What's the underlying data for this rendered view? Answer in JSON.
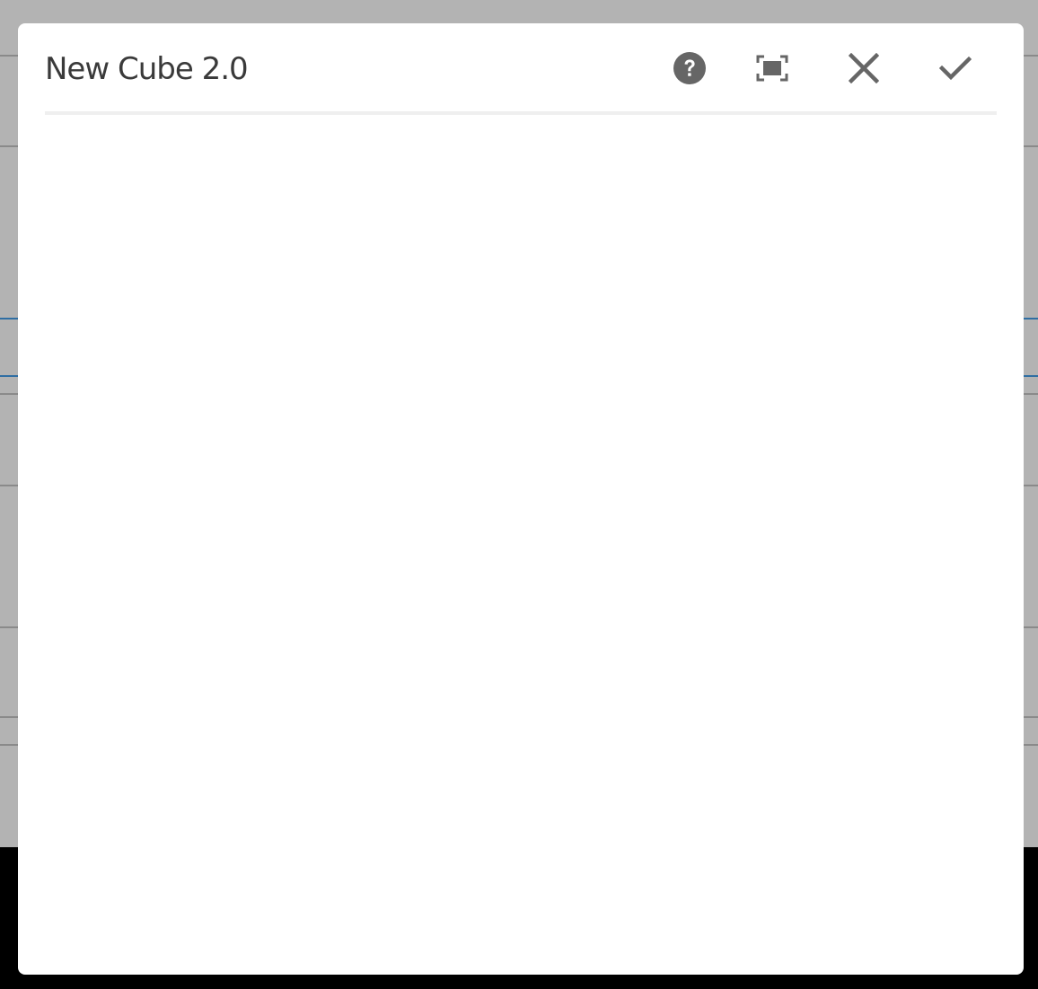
{
  "dialog": {
    "title": "New Cube 2.0",
    "actions": [
      {
        "name": "help",
        "icon": "help-circle-icon"
      },
      {
        "name": "fullscreen",
        "icon": "fullscreen-icon"
      },
      {
        "name": "close",
        "icon": "close-icon"
      },
      {
        "name": "confirm",
        "icon": "checkmark-icon"
      }
    ]
  },
  "colors": {
    "overlay": "#b3b3b3",
    "dialog_bg": "#ffffff",
    "icon": "#666666",
    "title": "#3a3a3a",
    "divider": "#efefef",
    "accent_line": "#2f6ea3"
  }
}
